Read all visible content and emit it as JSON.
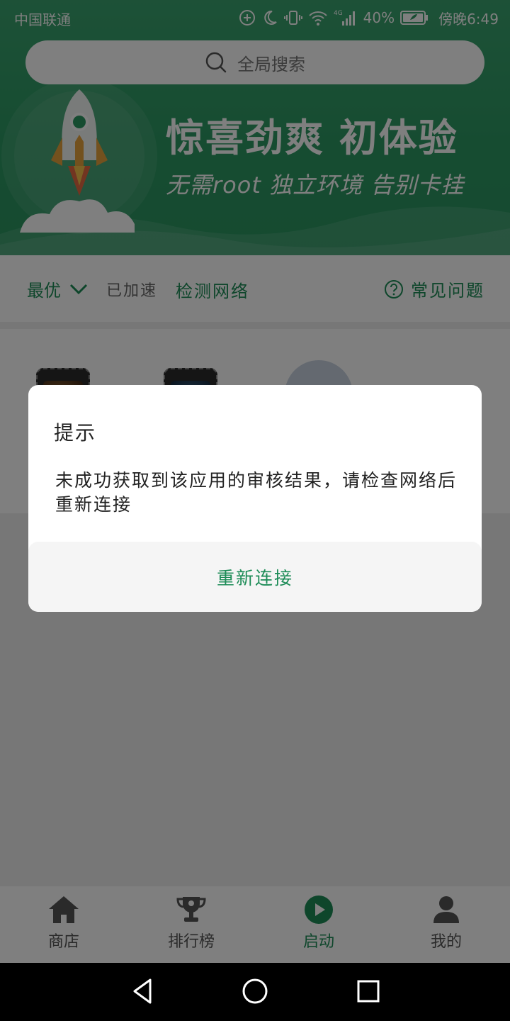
{
  "status_bar": {
    "carrier": "中国联通",
    "network": "4G",
    "battery": "40%",
    "time": "傍晚6:49"
  },
  "search": {
    "placeholder": "全局搜索"
  },
  "banner": {
    "title": "惊喜劲爽  初体验",
    "subtitle": "无需root  独立环境  告别卡挂"
  },
  "accel": {
    "mode": "最优",
    "status": "已加速",
    "detect": "检测网络",
    "faq": "常见问题"
  },
  "dialog": {
    "title": "提示",
    "message": "未成功获取到该应用的审核结果，请检查网络后重新连接",
    "button": "重新连接"
  },
  "tabs": [
    {
      "label": "商店",
      "icon": "home-icon",
      "active": false
    },
    {
      "label": "排行榜",
      "icon": "trophy-icon",
      "active": false
    },
    {
      "label": "启动",
      "icon": "play-icon",
      "active": true
    },
    {
      "label": "我的",
      "icon": "person-icon",
      "active": false
    }
  ],
  "colors": {
    "brand_green": "#1d8c57",
    "banner_green": "#2d9963"
  }
}
